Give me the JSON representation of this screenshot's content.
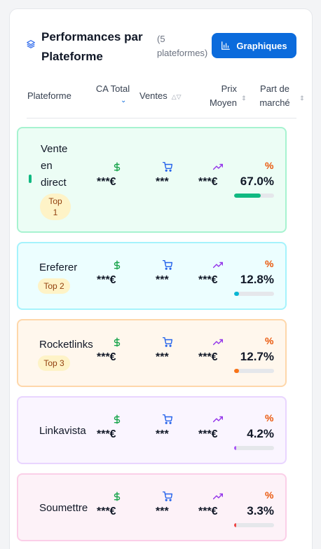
{
  "header": {
    "title": "Performances par Plateforme",
    "count": "(5 plateformes)",
    "button_label": "Graphiques"
  },
  "columns": {
    "platform": "Plateforme",
    "ca": "CA Total",
    "sales": "Ventes",
    "price": "Prix Moyen",
    "share": "Part de marché"
  },
  "rows": [
    {
      "name": "Vente en direct",
      "badge": "Top 1",
      "ca": "***€",
      "sales": "***",
      "price": "***€",
      "share": "67.0%",
      "share_value": 67.0,
      "bg": "#ecfdf5",
      "border": "#a7f3d0",
      "accent": "#10b981"
    },
    {
      "name": "Ereferer",
      "badge": "Top 2",
      "ca": "***€",
      "sales": "***",
      "price": "***€",
      "share": "12.8%",
      "share_value": 12.8,
      "bg": "#ecfeff",
      "border": "#a5f3fc",
      "accent": "#06b6d4"
    },
    {
      "name": "Rocketlinks",
      "badge": "Top 3",
      "ca": "***€",
      "sales": "***",
      "price": "***€",
      "share": "12.7%",
      "share_value": 12.7,
      "bg": "#fff7ed",
      "border": "#fed7aa",
      "accent": "#f97316"
    },
    {
      "name": "Linkavista",
      "badge": "",
      "ca": "***€",
      "sales": "***",
      "price": "***€",
      "share": "4.2%",
      "share_value": 4.2,
      "bg": "#faf5ff",
      "border": "#e9d5ff",
      "accent": "#a855f7"
    },
    {
      "name": "Soumettre",
      "badge": "",
      "ca": "***€",
      "sales": "***",
      "price": "***€",
      "share": "3.3%",
      "share_value": 3.3,
      "bg": "#fdf2f8",
      "border": "#fbcfe8",
      "accent": "#ef4444"
    }
  ],
  "icons": {
    "ca": "dollar-icon",
    "sales": "cart-icon",
    "price": "trending-up-icon",
    "share": "percent-icon"
  },
  "colors": {
    "primary": "#0b6bdc",
    "dollar": "#16a34a",
    "cart": "#2563eb",
    "trend": "#9333ea",
    "percent": "#ea580c"
  }
}
